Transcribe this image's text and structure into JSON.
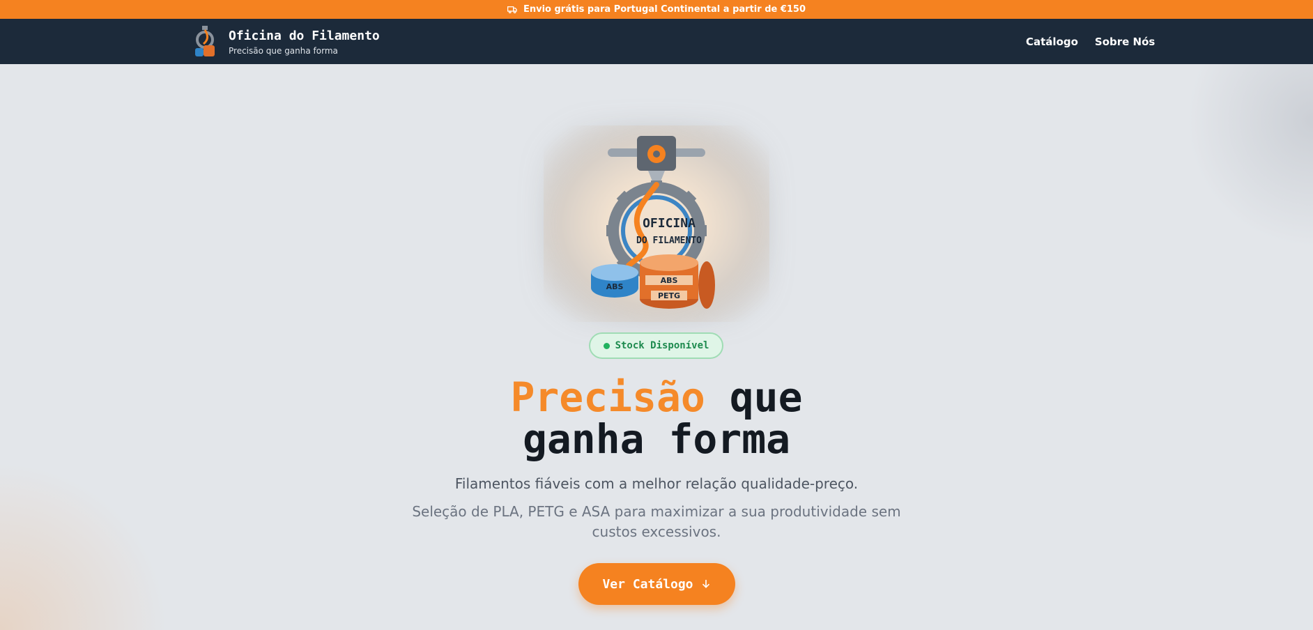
{
  "announcement": {
    "icon": "truck-icon",
    "text": "Envio grátis para Portugal Continental a partir de €150"
  },
  "nav": {
    "brand_title": "Oficina do Filamento",
    "brand_subtitle": "Precisão que ganha forma",
    "links": [
      "Catálogo",
      "Sobre Nós"
    ]
  },
  "hero": {
    "logo_text_line1": "OFICINA",
    "logo_text_line2": "DO FILAMENTO",
    "spool_labels": [
      "ABS",
      "ABS",
      "PETG"
    ],
    "badge": "Stock Disponível",
    "headline_accent": "Precisão",
    "headline_rest1": " que",
    "headline_line2": "ganha forma",
    "subtitle": "Filamentos fiáveis com a melhor relação qualidade-preço.",
    "description": "Seleção de PLA, PETG e ASA para maximizar a sua produtividade sem custos excessivos.",
    "cta_label": "Ver Catálogo",
    "cta_icon": "arrow-down-icon"
  },
  "colors": {
    "accent": "#f58220",
    "nav_bg": "#1c2a3a",
    "badge_green": "#1d8a4e"
  }
}
